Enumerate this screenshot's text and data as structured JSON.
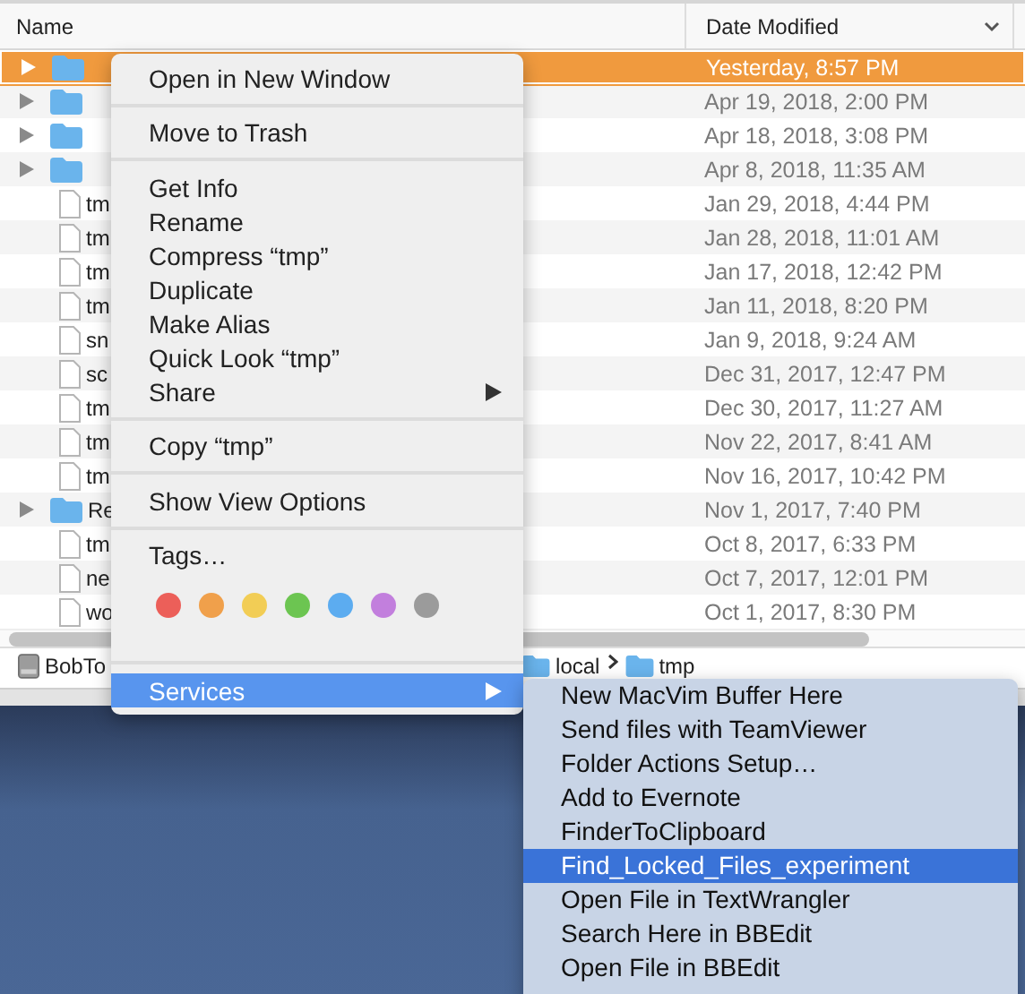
{
  "finder": {
    "columns": [
      "Name",
      "Date Modified"
    ],
    "rows": [
      {
        "kind": "folder",
        "selected": true,
        "date": "Yesterday, 8:57 PM"
      },
      {
        "kind": "folder",
        "selected": false,
        "date": "Apr 19, 2018, 2:00 PM"
      },
      {
        "kind": "folder",
        "selected": false,
        "date": "Apr 18, 2018, 3:08 PM"
      },
      {
        "kind": "folder",
        "selected": false,
        "date": "Apr 8, 2018, 11:35 AM"
      },
      {
        "kind": "file",
        "selected": false,
        "name": "tm",
        "date": "Jan 29, 2018, 4:44 PM"
      },
      {
        "kind": "file",
        "selected": false,
        "name": "tm",
        "date": "Jan 28, 2018, 11:01 AM"
      },
      {
        "kind": "file",
        "selected": false,
        "name": "tm",
        "date": "Jan 17, 2018, 12:42 PM"
      },
      {
        "kind": "file",
        "selected": false,
        "name": "tm",
        "date": "Jan 11, 2018, 8:20 PM"
      },
      {
        "kind": "file",
        "selected": false,
        "name": "sn",
        "date": "Jan 9, 2018, 9:24 AM"
      },
      {
        "kind": "file",
        "selected": false,
        "name": "sc",
        "date": "Dec 31, 2017, 12:47 PM"
      },
      {
        "kind": "file",
        "selected": false,
        "name": "tm",
        "date": "Dec 30, 2017, 11:27 AM"
      },
      {
        "kind": "file",
        "selected": false,
        "name": "tm",
        "date": "Nov 22, 2017, 8:41 AM"
      },
      {
        "kind": "file",
        "selected": false,
        "name": "tm",
        "date": "Nov 16, 2017, 10:42 PM"
      },
      {
        "kind": "folder",
        "selected": false,
        "name": "Re",
        "date": "Nov 1, 2017, 7:40 PM"
      },
      {
        "kind": "file",
        "selected": false,
        "name": "tm",
        "date": "Oct 8, 2017, 6:33 PM"
      },
      {
        "kind": "file",
        "selected": false,
        "name": "ne",
        "date": "Oct 7, 2017, 12:01 PM"
      },
      {
        "kind": "file",
        "selected": false,
        "name": "wo",
        "date": "Oct 1, 2017, 8:30 PM"
      }
    ],
    "path_bar": [
      {
        "kind": "disk",
        "label": "BobTo"
      },
      {
        "kind": "folder",
        "label": "local"
      },
      {
        "kind": "folder",
        "label": "tmp"
      }
    ]
  },
  "context_menu": [
    {
      "kind": "item",
      "label": "Open in New Window",
      "selected": false
    },
    {
      "kind": "separator"
    },
    {
      "kind": "item",
      "label": "Move to Trash",
      "selected": false
    },
    {
      "kind": "separator"
    },
    {
      "kind": "item",
      "label": "Get Info",
      "selected": false
    },
    {
      "kind": "item",
      "label": "Rename",
      "selected": false
    },
    {
      "kind": "item",
      "label": "Compress “tmp”",
      "selected": false
    },
    {
      "kind": "item",
      "label": "Duplicate",
      "selected": false
    },
    {
      "kind": "item",
      "label": "Make Alias",
      "selected": false
    },
    {
      "kind": "item",
      "label": "Quick Look “tmp”",
      "selected": false
    },
    {
      "kind": "submenu",
      "label": "Share",
      "selected": false
    },
    {
      "kind": "separator"
    },
    {
      "kind": "item",
      "label": "Copy “tmp”",
      "selected": false
    },
    {
      "kind": "separator"
    },
    {
      "kind": "item",
      "label": "Show View Options",
      "selected": false
    },
    {
      "kind": "separator"
    },
    {
      "kind": "item",
      "label": "Tags…",
      "selected": false
    },
    {
      "kind": "tags",
      "tags": [
        {
          "color": "#ec5f59"
        },
        {
          "color": "#f0a04b"
        },
        {
          "color": "#f2cd55"
        },
        {
          "color": "#6cc551"
        },
        {
          "color": "#5cacf0"
        },
        {
          "color": "#c27fdd"
        },
        {
          "color": "#9b9b9b"
        }
      ]
    },
    {
      "kind": "separator"
    },
    {
      "kind": "submenu",
      "label": "Services",
      "selected": true
    }
  ],
  "services_menu": [
    {
      "label": "New MacVim Buffer Here",
      "selected": false
    },
    {
      "label": "Send files with TeamViewer",
      "selected": false
    },
    {
      "label": "Folder Actions Setup…",
      "selected": false
    },
    {
      "label": "Add to Evernote",
      "selected": false
    },
    {
      "label": "FinderToClipboard",
      "selected": false
    },
    {
      "label": "Find_Locked_Files_experiment",
      "selected": true
    },
    {
      "label": "Open File in TextWrangler",
      "selected": false
    },
    {
      "label": "Search Here in BBEdit",
      "selected": false
    },
    {
      "label": "Open File in BBEdit",
      "selected": false
    }
  ]
}
